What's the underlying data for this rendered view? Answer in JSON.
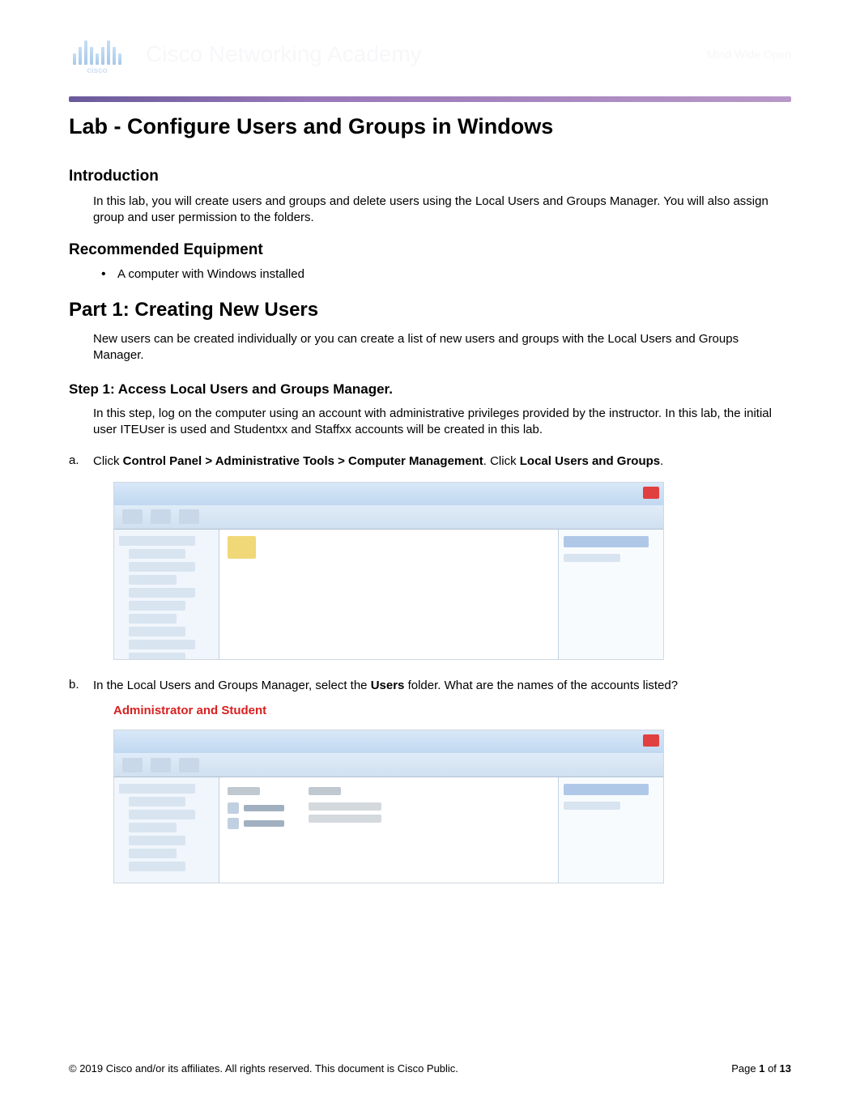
{
  "header": {
    "brand": "cisco",
    "academy": "Cisco Networking Academy",
    "tagline": "Mind Wide Open"
  },
  "title": "Lab - Configure Users and Groups in Windows",
  "intro": {
    "heading": "Introduction",
    "body": "In this lab, you will create users and groups and delete users using the Local Users and Groups Manager. You will also assign group and user permission to the folders."
  },
  "equipment": {
    "heading": "Recommended Equipment",
    "items": [
      "A computer with Windows installed"
    ]
  },
  "part1": {
    "heading": "Part 1: Creating New Users",
    "body": "New users can be created individually or you can create a list of new users and groups with the Local Users and Groups Manager."
  },
  "step1": {
    "heading": "Step 1: Access Local Users and Groups Manager.",
    "body": "In this step, log on the computer using an account with administrative privileges provided by the instructor. In this lab, the initial user ITEUser is used and Studentxx and Staffxx accounts will be created in this lab.",
    "a": {
      "marker": "a.",
      "prefix": "Click ",
      "path": "Control Panel > Administrative Tools > Computer Management",
      "middle": ". Click ",
      "target": "Local Users and Groups",
      "suffix": "."
    },
    "b": {
      "marker": "b.",
      "prefix": "In the Local Users and Groups Manager, select the ",
      "bold": "Users",
      "suffix": " folder. What are the names of the accounts listed?",
      "answer": "Administrator and Student"
    }
  },
  "footer": {
    "copyright": "© 2019 Cisco and/or its affiliates. All rights reserved. This document is Cisco Public.",
    "page_prefix": "Page ",
    "page_current": "1",
    "page_middle": " of ",
    "page_total": "13"
  }
}
